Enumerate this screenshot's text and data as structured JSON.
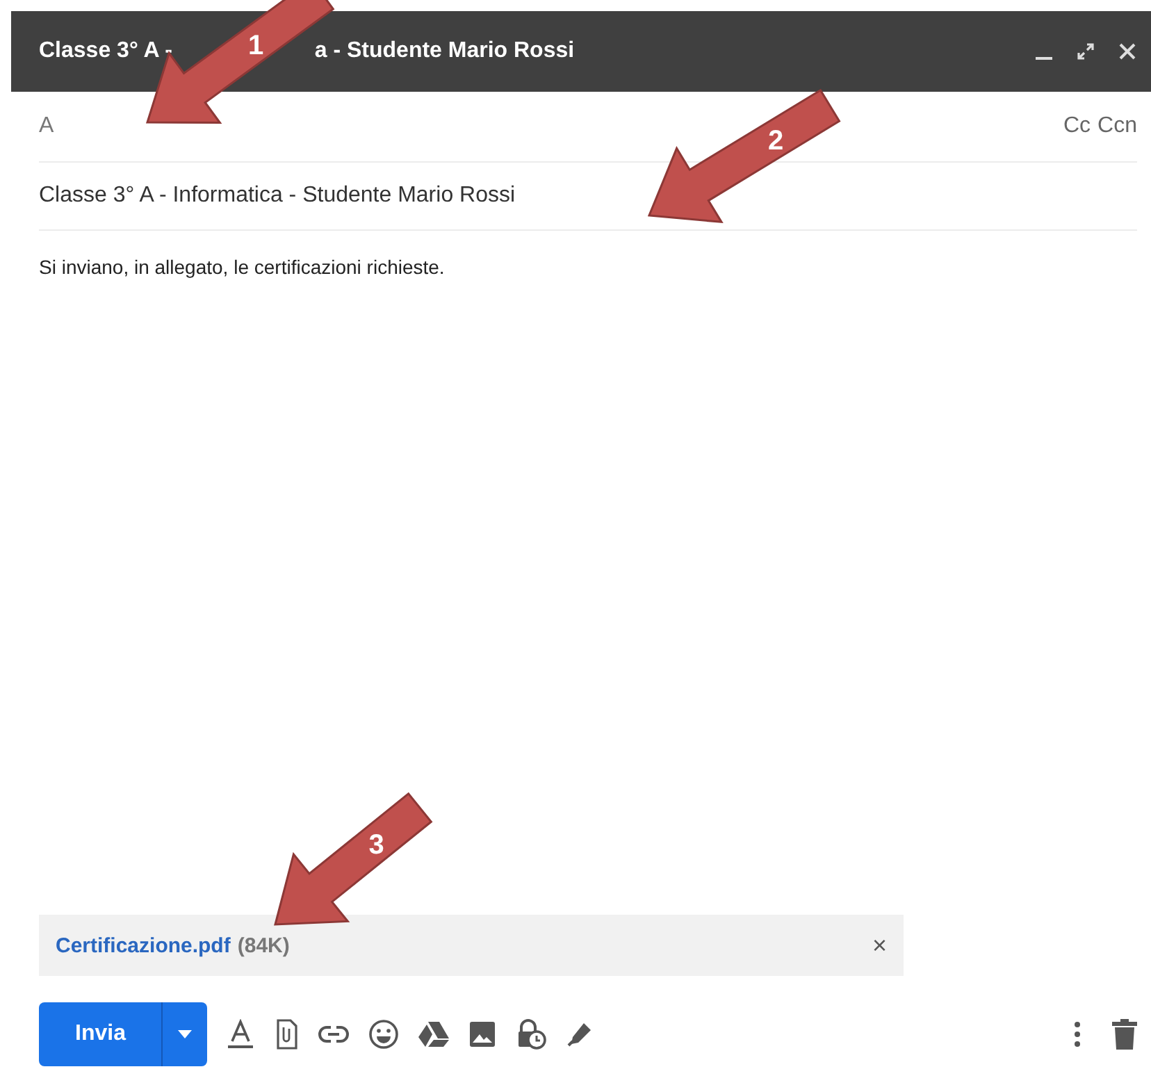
{
  "window": {
    "title_parts": [
      "Classe 3° A - ",
      "a - Studente Mario Rossi"
    ]
  },
  "recipients": {
    "label": "A",
    "cc_links": [
      "Cc",
      "Ccn"
    ]
  },
  "subject": {
    "value": "Classe 3° A - Informatica - Studente Mario Rossi"
  },
  "body": {
    "text": "Si inviano, in allegato, le certificazioni richieste."
  },
  "attachment": {
    "name": "Certificazione.pdf",
    "size": "(84K)",
    "remove": "×"
  },
  "toolbar": {
    "send": "Invia"
  },
  "callouts": [
    {
      "number": "1"
    },
    {
      "number": "2"
    },
    {
      "number": "3"
    }
  ]
}
